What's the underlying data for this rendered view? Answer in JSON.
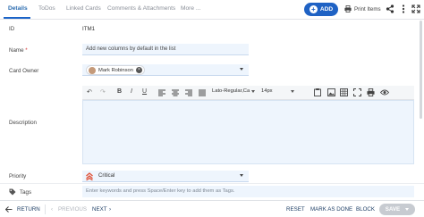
{
  "tabs": [
    {
      "label": "Details",
      "active": true
    },
    {
      "label": "ToDos"
    },
    {
      "label": "Linked Cards"
    },
    {
      "label": "Comments & Attachments"
    },
    {
      "label": "More ..."
    }
  ],
  "header": {
    "add_label": "ADD",
    "print_label": "Print Items",
    "icons": [
      "printer-icon",
      "share-icon",
      "more-vertical-icon",
      "expand-icon"
    ]
  },
  "form": {
    "id_label": "ID",
    "id_value": "ITM1",
    "name_label": "Name",
    "name_required": "*",
    "name_value": "Add new columns by default in the list",
    "owner_label": "Card Owner",
    "owner_value": "Mark Robinson",
    "description_label": "Description",
    "priority_label": "Priority",
    "priority_value": "Critical",
    "tags_label": "Tags",
    "tags_placeholder": "Enter keywords and press Space/Enter key to add them as Tags."
  },
  "editor_toolbar": {
    "font": "Lato-Regular,Ca",
    "size": "14px",
    "icons": [
      "undo-icon",
      "redo-icon",
      "bold-icon",
      "italic-icon",
      "underline-icon",
      "align-left-icon",
      "align-center-icon",
      "align-right-icon",
      "align-justify-icon",
      "paste-icon",
      "image-icon",
      "table-icon",
      "fullscreen-icon",
      "print-icon",
      "preview-icon"
    ]
  },
  "footer": {
    "return_label": "RETURN",
    "previous_label": "PREVIOUS",
    "next_label": "NEXT",
    "reset_label": "RESET",
    "mark_done_label": "MARK AS DONE",
    "block_label": "BLOCK",
    "save_label": "SAVE"
  },
  "colors": {
    "accent": "#1f62c4",
    "field_bg": "#eef5fd",
    "priority_critical": "#e0533a"
  }
}
